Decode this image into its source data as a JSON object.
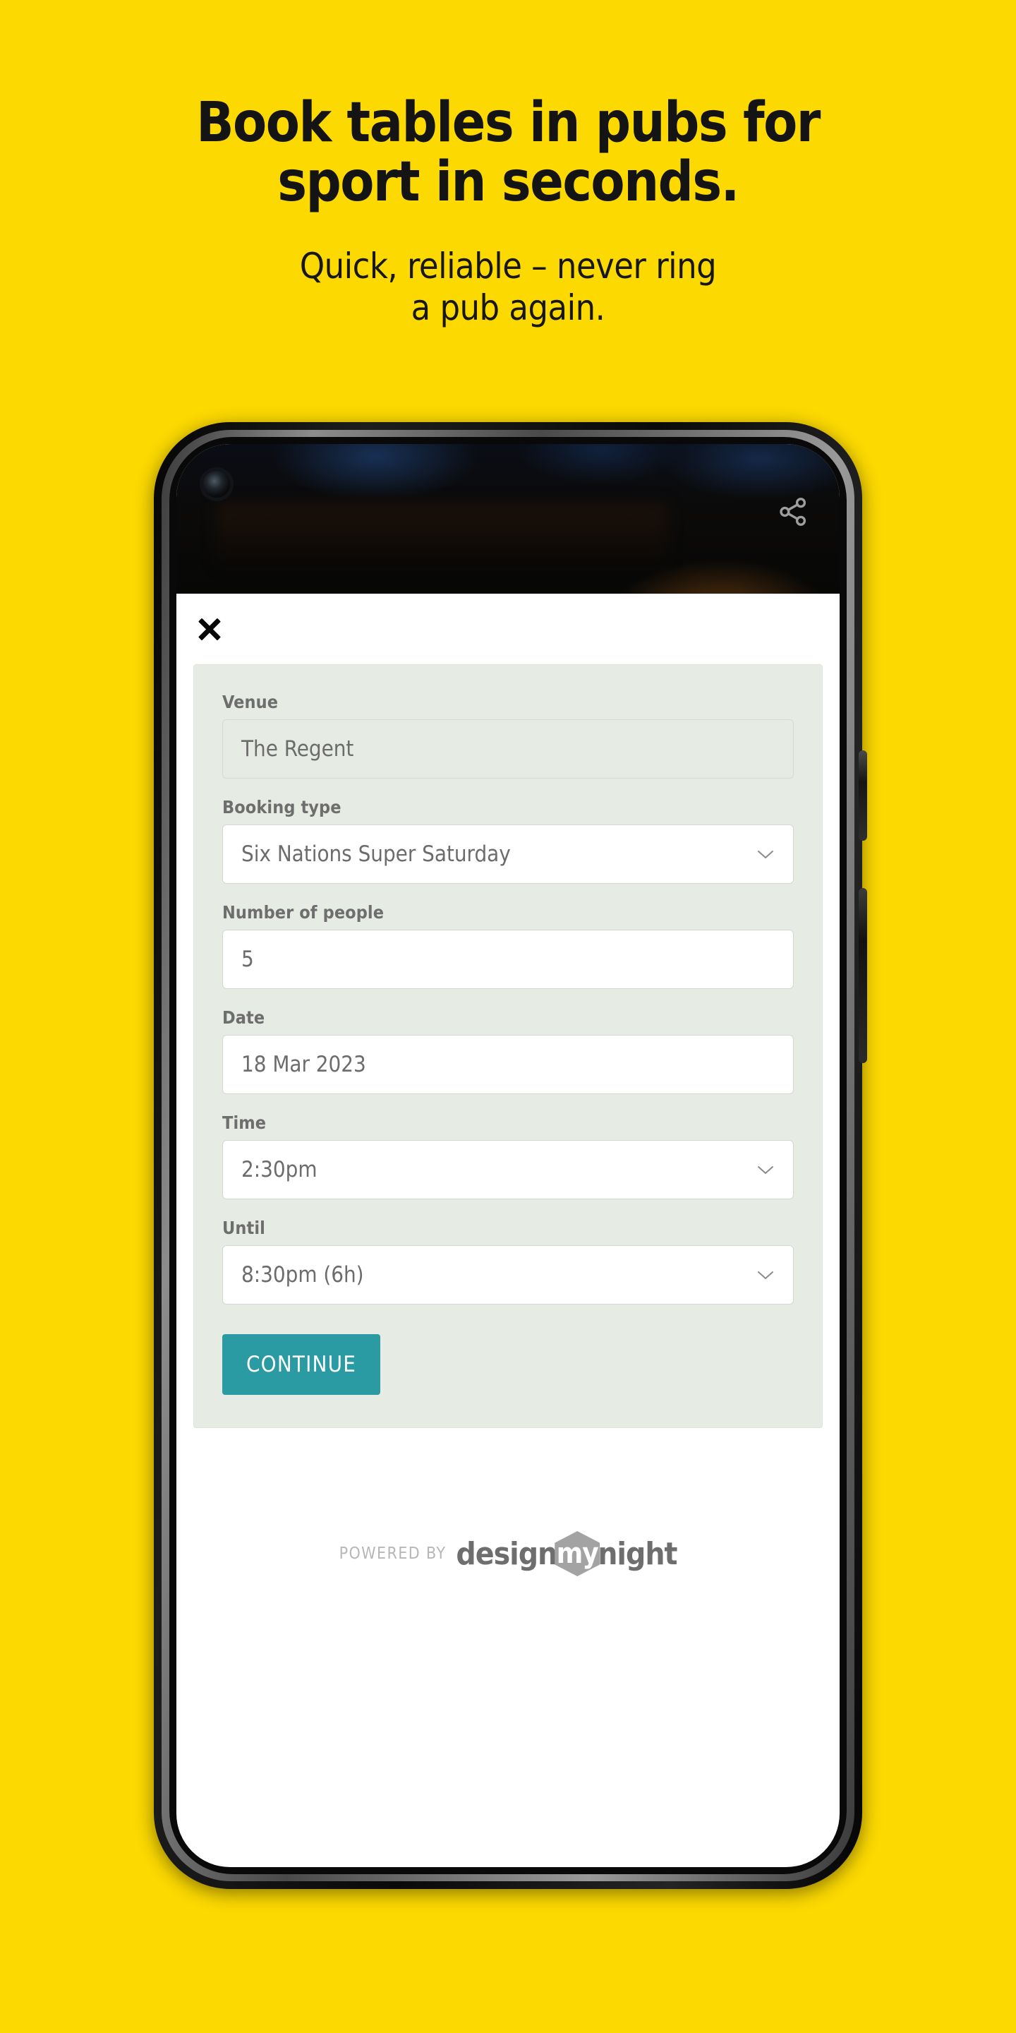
{
  "promo": {
    "headline_line1": "Book tables in pubs for",
    "headline_line2": "sport in seconds.",
    "subhead_line1": "Quick, reliable – never ring",
    "subhead_line2": "a pub again."
  },
  "colors": {
    "background_yellow": "#FCD900",
    "accent_teal": "#2a9aa3",
    "panel_sage": "#e6ebe4",
    "label_gray": "#6e6e6e",
    "value_gray": "#6c6c6c"
  },
  "phone_app": {
    "hero": {
      "camera_icon": "camera-punch-hole",
      "share_icon": "share-icon"
    },
    "close_label": "×",
    "form": {
      "fields": [
        {
          "label": "Venue",
          "value": "The Regent",
          "type": "text",
          "disabled": true
        },
        {
          "label": "Booking type",
          "value": "Six Nations Super Saturday",
          "type": "select",
          "disabled": false
        },
        {
          "label": "Number of people",
          "value": "5",
          "type": "text",
          "disabled": false
        },
        {
          "label": "Date",
          "value": "18 Mar 2023",
          "type": "text",
          "disabled": false
        },
        {
          "label": "Time",
          "value": "2:30pm",
          "type": "select",
          "disabled": false
        },
        {
          "label": "Until",
          "value": "8:30pm (6h)",
          "type": "select",
          "disabled": false
        }
      ],
      "submit_label": "CONTINUE"
    },
    "footer": {
      "powered_by": "POWERED BY",
      "brand_part1": "design",
      "brand_part2": "my",
      "brand_part3": "night"
    }
  }
}
